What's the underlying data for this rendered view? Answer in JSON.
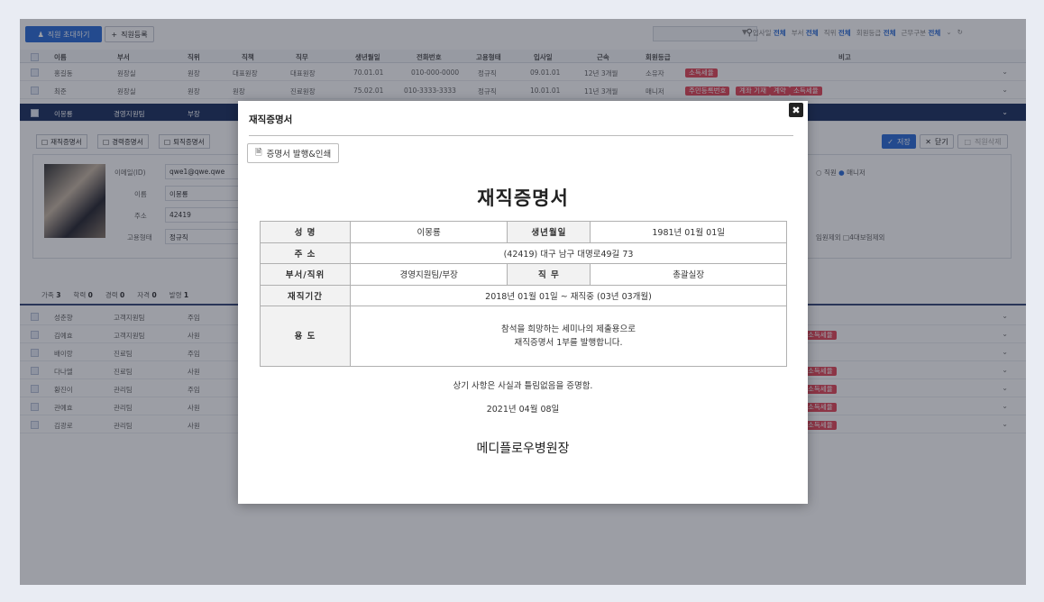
{
  "toolbar": {
    "invite_label": "직원 초대하기",
    "register_label": "직원등록",
    "search_placeholder": "",
    "filters": [
      {
        "key": "입사일",
        "value": "전체"
      },
      {
        "key": "부서",
        "value": "전체"
      },
      {
        "key": "직위",
        "value": "전체"
      },
      {
        "key": "회원등급",
        "value": "전체"
      },
      {
        "key": "근무구분",
        "value": "전체"
      }
    ]
  },
  "table": {
    "headers": [
      "이름",
      "부서",
      "직위",
      "직책",
      "직무",
      "생년월일",
      "전화번호",
      "고용형태",
      "입사일",
      "근속",
      "회원등급",
      "비고"
    ],
    "top_rows": [
      {
        "name": "홍길동",
        "dept": "원장실",
        "pos": "원장",
        "title": "대표원장",
        "duty": "대표원장",
        "birth": "70.01.01",
        "phone": "010-000-0000",
        "type": "정규직",
        "join": "09.01.01",
        "tenure": "12년 3개월",
        "grade": "소유자",
        "badges": [
          "소득세율"
        ]
      },
      {
        "name": "최준",
        "dept": "원장실",
        "pos": "원장",
        "title": "원장",
        "duty": "진료원장",
        "birth": "75.02.01",
        "phone": "010-3333-3333",
        "type": "정규직",
        "join": "10.01.01",
        "tenure": "11년 3개월",
        "grade": "매니저",
        "badges": [
          "주민등록번호",
          "계좌 기재",
          "계약",
          "소득세율"
        ]
      },
      {
        "name": "이몽룡",
        "dept": "경영지원팀",
        "pos": "부장",
        "active": true
      }
    ],
    "bottom_rows": [
      {
        "name": "성춘향",
        "dept": "고객지원팀",
        "pos": "주임",
        "badge": false
      },
      {
        "name": "김예효",
        "dept": "고객지원팀",
        "pos": "사원",
        "badge": true
      },
      {
        "name": "배이랑",
        "dept": "진료팀",
        "pos": "주임",
        "badge": false
      },
      {
        "name": "다나엘",
        "dept": "진료팀",
        "pos": "사원",
        "badge": true
      },
      {
        "name": "황진이",
        "dept": "관리팀",
        "pos": "주임",
        "badge": true
      },
      {
        "name": "관예효",
        "dept": "관리팀",
        "pos": "사원",
        "badge": true
      },
      {
        "name": "김광로",
        "dept": "관리팀",
        "pos": "사원",
        "badge": true
      }
    ],
    "badge_text": "소득세율"
  },
  "detail": {
    "doc_buttons": [
      "재직증명서",
      "경력증명서",
      "퇴직증명서"
    ],
    "save_label": "저장",
    "close_label": "닫기",
    "delete_label": "직원삭제",
    "fields": [
      {
        "label": "이메일(ID)",
        "value": "qwe1@qwe.qwe"
      },
      {
        "label": "이름",
        "value": "이몽룡"
      },
      {
        "label": "주소",
        "value": "42419"
      },
      {
        "label": "고용형태",
        "value": "정규직"
      }
    ],
    "role_options": {
      "unselected": "직원",
      "selected": "매니저"
    },
    "check_options": [
      "임원제외",
      "4대보험제외"
    ],
    "tabs": [
      {
        "label": "가족",
        "count": "3"
      },
      {
        "label": "학력",
        "count": "0"
      },
      {
        "label": "경력",
        "count": "0"
      },
      {
        "label": "자격",
        "count": "0"
      },
      {
        "label": "발령",
        "count": "1"
      }
    ]
  },
  "modal": {
    "title": "재직증명서",
    "print_button": "증명서 발행&인쇄",
    "doc_title": "재직증명서",
    "table": {
      "name_label": "성    명",
      "name_value": "이몽룡",
      "birth_label": "생년월일",
      "birth_value": "1981년 01월 01일",
      "address_label": "주    소",
      "address_value": "(42419) 대구 남구 대명로49길 73",
      "dept_label": "부서/직위",
      "dept_value": "경영지원팀/부장",
      "duty_label": "직    무",
      "duty_value": "총괄실장",
      "period_label": "재직기간",
      "period_value": "2018년 01월 01일 ~ 재직중 (03년 03개월)",
      "purpose_label": "용    도",
      "purpose_line1": "참석을 희망하는 세미나의 제출용으로",
      "purpose_line2": "재직증명서 1부를 발행합니다."
    },
    "confirm_text": "상기 사항은 사실과 틀림없음을 증명함.",
    "date_text": "2021년 04월 08일",
    "signer": "메디플로우병원장"
  }
}
